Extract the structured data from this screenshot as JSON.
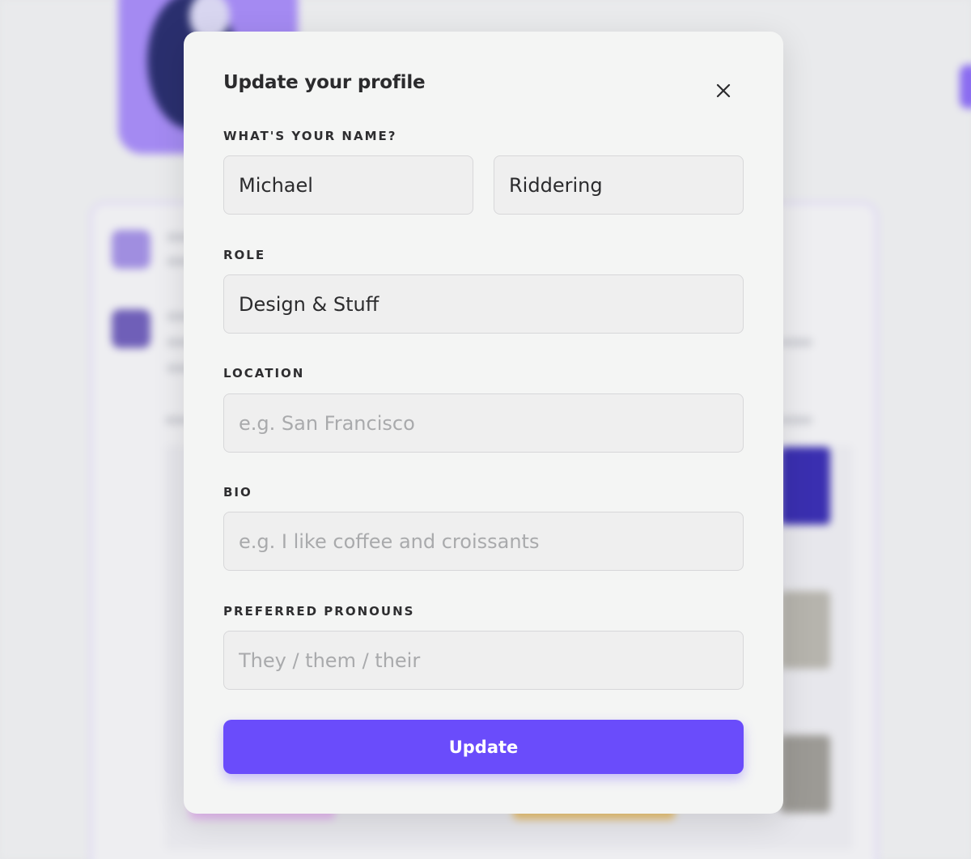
{
  "modal": {
    "title": "Update your profile",
    "close_icon": "close-icon",
    "name_label": "WHAT'S YOUR NAME?",
    "first_name_value": "Michael",
    "last_name_value": "Riddering",
    "role_label": "ROLE",
    "role_value": "Design & Stuff",
    "location_label": "LOCATION",
    "location_placeholder": "e.g. San Francisco",
    "bio_label": "BIO",
    "bio_placeholder": "e.g. I like coffee and croissants",
    "pronouns_label": "PREFERRED PRONOUNS",
    "pronouns_placeholder": "They / them / their",
    "update_label": "Update"
  },
  "colors": {
    "accent": "#6a4cfb",
    "modal_background": "#f4f5f4",
    "input_background": "#efefef",
    "page_background": "#e6e7e9"
  }
}
